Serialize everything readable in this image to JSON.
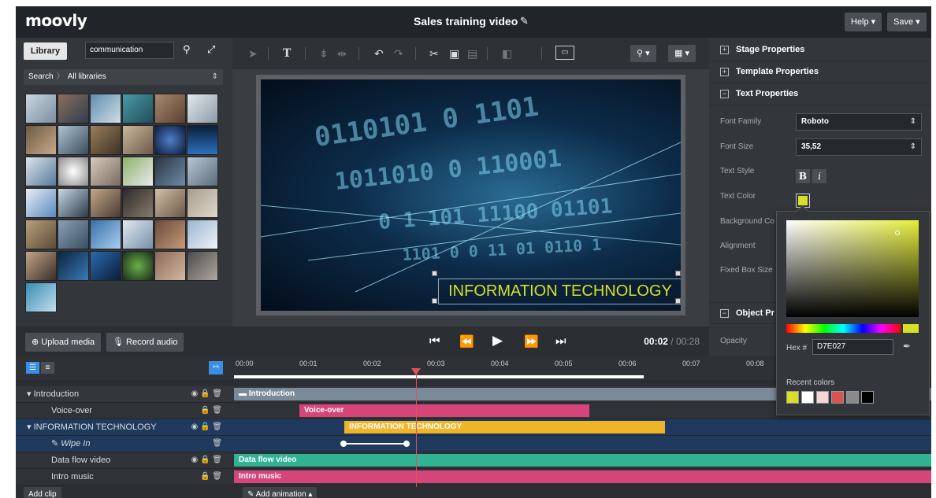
{
  "app": {
    "logo": "moovly",
    "title": "Sales training video",
    "help_label": "Help ▾",
    "save_label": "Save ▾"
  },
  "library": {
    "tab_label": "Library",
    "search_value": "communication",
    "breadcrumb_root": "Search",
    "breadcrumb_current": "All libraries",
    "upload_label": "Upload media",
    "record_label": "Record audio"
  },
  "stage": {
    "text_object": "INFORMATION TECHNOLOGY",
    "time_current": "00:02",
    "time_separator": " / ",
    "time_total": "00:28"
  },
  "properties": {
    "sections": [
      "Stage Properties",
      "Template Properties",
      "Text Properties",
      "Object Pr"
    ],
    "labels": {
      "font_family": "Font Family",
      "font_size": "Font Size",
      "text_style": "Text Style",
      "text_color": "Text Color",
      "background": "Background Co",
      "alignment": "Alignment",
      "fixed_box": "Fixed Box Size",
      "opacity": "Opacity"
    },
    "font_family_value": "Roboto",
    "font_size_value": "35,52",
    "bold_label": "B",
    "italic_label": "i"
  },
  "picker": {
    "hex_label": "Hex #",
    "hex_value": "D7E027",
    "recent_label": "Recent colors",
    "recent_colors": [
      "#d7e027",
      "#ffffff",
      "#f5d6d6",
      "#d9534f",
      "#8a8a8a",
      "#000000"
    ],
    "selected_color": "#d7e027"
  },
  "timeline": {
    "ticks": [
      "00:00",
      "00:01",
      "00:02",
      "00:03",
      "00:04",
      "00:05",
      "00:06",
      "00:07",
      "00:08"
    ],
    "rows": [
      {
        "name": "Introduction",
        "clip": "Introduction"
      },
      {
        "name": "Voice-over",
        "clip": "Voice-over"
      },
      {
        "name": "INFORMATION TECHNOLOGY",
        "clip": "INFORMATION TECHNOLOGY"
      },
      {
        "name": "Wipe In",
        "clip": ""
      },
      {
        "name": "Data flow video",
        "clip": "Data flow video"
      },
      {
        "name": "Intro music",
        "clip": "Intro music"
      }
    ],
    "add_clip_label": "Add clip",
    "add_animation_label": "Add animation ▴"
  },
  "colors": {
    "accent_yellow": "#d7e027",
    "voiceover_pink": "#d6457a",
    "text_clip_gold": "#f0b429",
    "video_teal": "#2fb393",
    "music_pink": "#d6457a",
    "intro_gray": "#7b8a99"
  }
}
